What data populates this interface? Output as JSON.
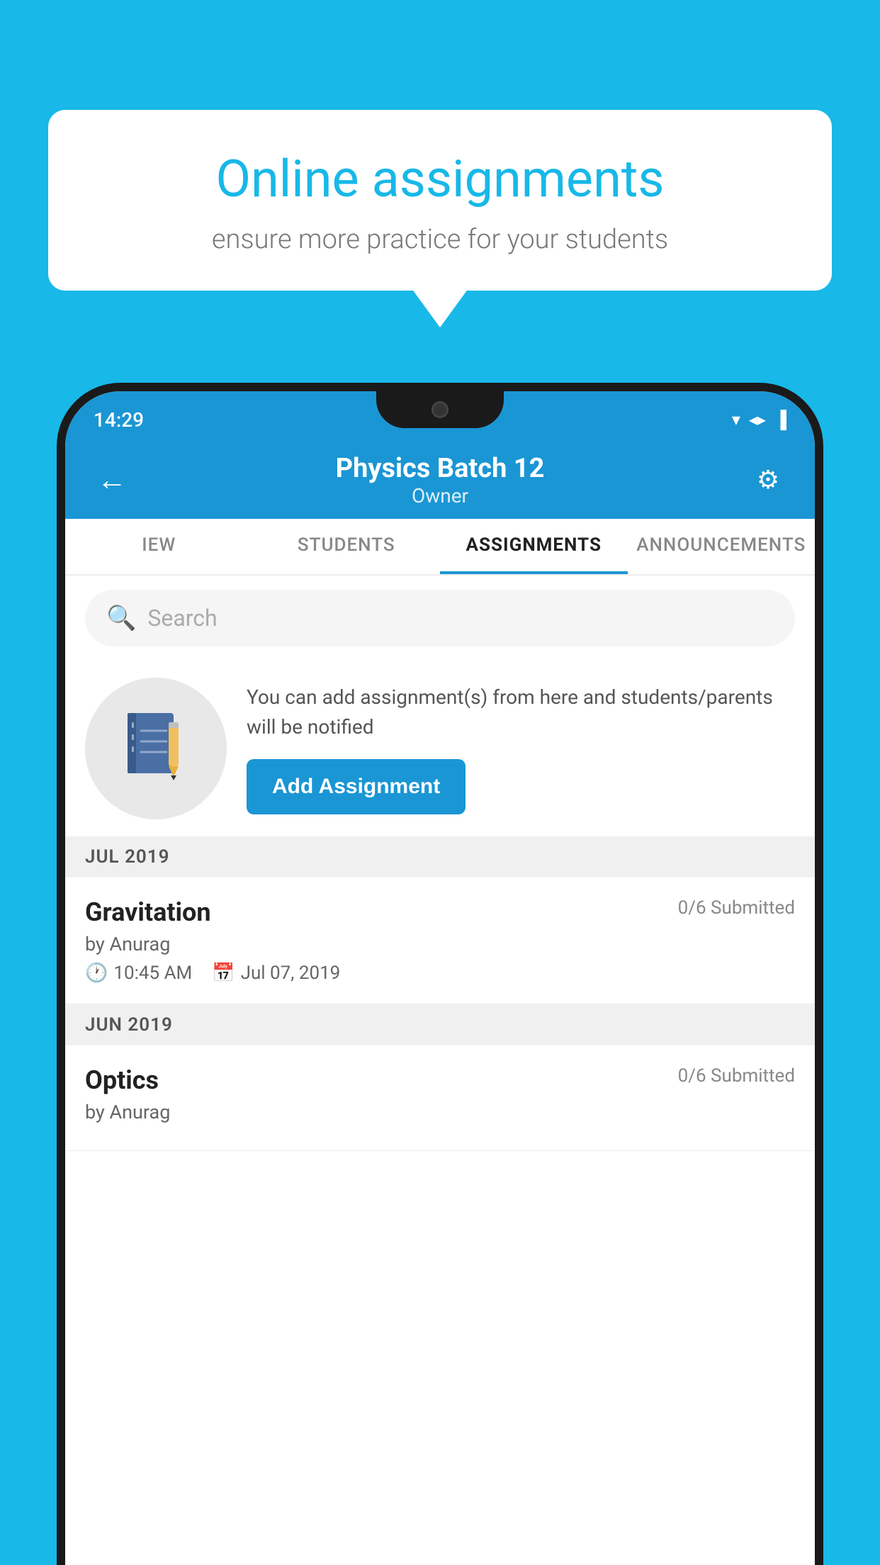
{
  "page": {
    "background_color": "#18b8e8"
  },
  "speech_bubble": {
    "title": "Online assignments",
    "subtitle": "ensure more practice for your students"
  },
  "status_bar": {
    "time": "14:29",
    "wifi_icon": "▲",
    "signal_icon": "▲",
    "battery_icon": "▐"
  },
  "header": {
    "back_label": "←",
    "title": "Physics Batch 12",
    "subtitle": "Owner",
    "settings_icon": "⚙"
  },
  "tabs": [
    {
      "id": "iew",
      "label": "IEW",
      "active": false
    },
    {
      "id": "students",
      "label": "STUDENTS",
      "active": false
    },
    {
      "id": "assignments",
      "label": "ASSIGNMENTS",
      "active": true
    },
    {
      "id": "announcements",
      "label": "ANNOUNCEMENTS",
      "active": false
    }
  ],
  "search": {
    "placeholder": "Search"
  },
  "info_section": {
    "description": "You can add assignment(s) from here and students/parents will be notified",
    "button_label": "Add Assignment"
  },
  "sections": [
    {
      "id": "jul2019",
      "label": "JUL 2019",
      "assignments": [
        {
          "id": "gravitation",
          "title": "Gravitation",
          "submitted": "0/6 Submitted",
          "by": "by Anurag",
          "time": "10:45 AM",
          "date": "Jul 07, 2019"
        }
      ]
    },
    {
      "id": "jun2019",
      "label": "JUN 2019",
      "assignments": [
        {
          "id": "optics",
          "title": "Optics",
          "submitted": "0/6 Submitted",
          "by": "by Anurag",
          "time": "",
          "date": ""
        }
      ]
    }
  ]
}
